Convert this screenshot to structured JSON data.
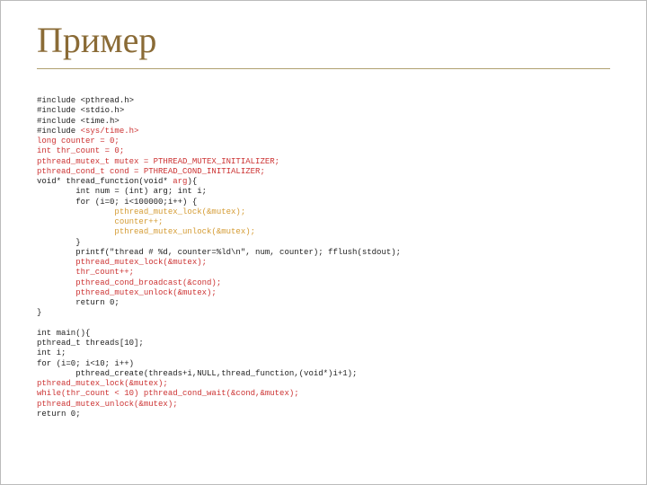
{
  "title": "Пример",
  "code": {
    "l1": "#include <pthread.h>",
    "l2": "#include <stdio.h>",
    "l3": "#include <time.h>",
    "l4a": "#include ",
    "l4b": "<sys/time.h>",
    "l5": "long counter = 0;",
    "l6": "int thr_count = 0;",
    "l7": "pthread_mutex_t mutex = PTHREAD_MUTEX_INITIALIZER;",
    "l8": "pthread_cond_t cond = PTHREAD_COND_INITIALIZER;",
    "l9a": "void* thread_function(void* ",
    "l9b": "arg",
    "l9c": "){",
    "l10": "        int num = (int) arg; int i;",
    "l11": "        for (i=0; i<100000;i++) {",
    "l12": "                pthread_mutex_lock(&mutex);",
    "l13": "                counter++;",
    "l14": "                pthread_mutex_unlock(&mutex);",
    "l15": "        }",
    "l16": "        printf(\"thread # %d, counter=%ld\\n\", num, counter); fflush(stdout);",
    "l17": "        pthread_mutex_lock(&mutex);",
    "l18": "        thr_count++;",
    "l19": "        pthread_cond_broadcast(&cond);",
    "l20": "        pthread_mutex_unlock(&mutex);",
    "l21": "        return 0;",
    "l22": "}",
    "blank1": "",
    "l23": "int main(){",
    "l24": "pthread_t threads[10];",
    "l25": "int i;",
    "l26": "for (i=0; i<10; i++)",
    "l27": "        pthread_create(threads+i,NULL,thread_function,(void*)i+1);",
    "l28": "pthread_mutex_lock(&mutex);",
    "l29": "while(thr_count < 10) pthread_cond_wait(&cond,&mutex);",
    "l30": "pthread_mutex_unlock(&mutex);",
    "l31": "return 0;"
  }
}
